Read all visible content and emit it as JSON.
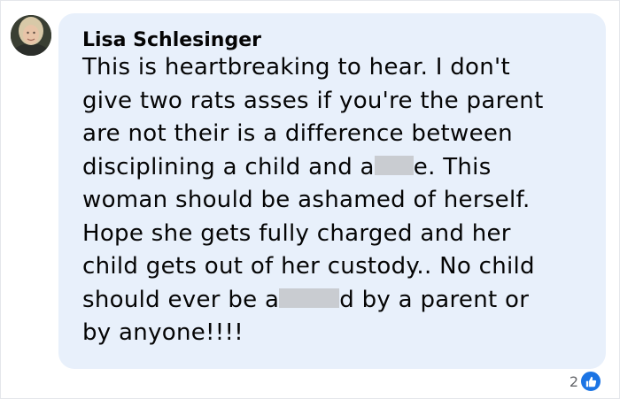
{
  "comment": {
    "author": "Lisa Schlesinger",
    "lines": [
      [
        "This is heartbreaking to hear. I don't"
      ],
      [
        "give two rats asses if you're the parent"
      ],
      [
        "are not their is a difference between"
      ],
      [
        "disciplining a child and a",
        "e. This"
      ],
      [
        "woman should be ashamed of herself."
      ],
      [
        "Hope she gets fully charged and her"
      ],
      [
        "child gets out of her custody.. No child"
      ],
      [
        "should ever be a",
        "d by a parent or"
      ],
      [
        "by anyone!!!!"
      ]
    ]
  },
  "reactions": {
    "count": "2",
    "icon": "thumbs-up-icon",
    "color": "#1b74e4"
  }
}
